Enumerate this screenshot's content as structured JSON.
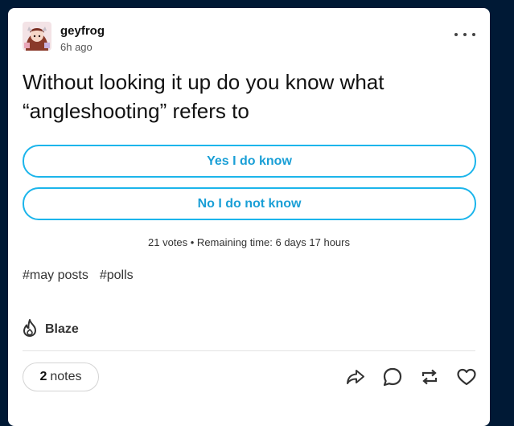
{
  "post": {
    "username": "geyfrog",
    "time": "6h ago",
    "title": "Without looking it up do you know what “angleshooting” refers to",
    "more_icon": "more-dots-icon"
  },
  "poll": {
    "options": [
      "Yes I do know",
      "No I do not know"
    ],
    "meta": "21 votes • Remaining time: 6 days 17 hours",
    "accent_color": "#1cb5eb"
  },
  "tags": [
    "#may posts",
    "#polls"
  ],
  "footer": {
    "blaze_label": "Blaze",
    "notes_count": "2",
    "notes_label": "notes",
    "actions": [
      "share-icon",
      "reply-icon",
      "reblog-icon",
      "like-icon"
    ]
  },
  "colors": {
    "background": "#001935",
    "card": "#ffffff"
  }
}
